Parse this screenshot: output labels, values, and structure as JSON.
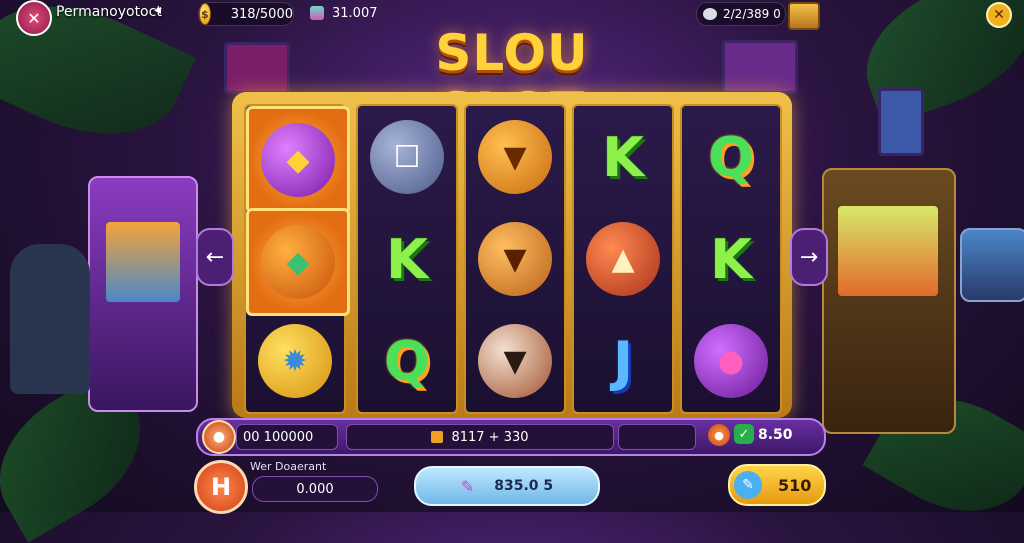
{
  "top_bar": {
    "player_name": "Permanoyotoct",
    "coins_balance": "318/5000",
    "gems_balance": "31.007",
    "right_balance": "2/2/389 0"
  },
  "title": "SLOU SLOT",
  "reels": [
    [
      "purple-mask-orb",
      "orange-horned-gem",
      "golden-sun-orb"
    ],
    [
      "robot-head",
      "K",
      "Q"
    ],
    [
      "fox-head",
      "dog-head",
      "raccoon-head"
    ],
    [
      "K",
      "red-horn",
      "J"
    ],
    [
      "Q",
      "K",
      "purple-monster"
    ]
  ],
  "status_bar": {
    "win_amount": "00 100000",
    "bet_info": "8117 + 330",
    "credit_value": "8.50"
  },
  "bottom": {
    "label": "Wer Doaerant",
    "value": "0.000",
    "spin_total": "835.0 5",
    "bet_button": "510"
  },
  "colors": {
    "accent": "#ffd23a",
    "panel": "#3c1766",
    "frame": "#c98f22"
  }
}
